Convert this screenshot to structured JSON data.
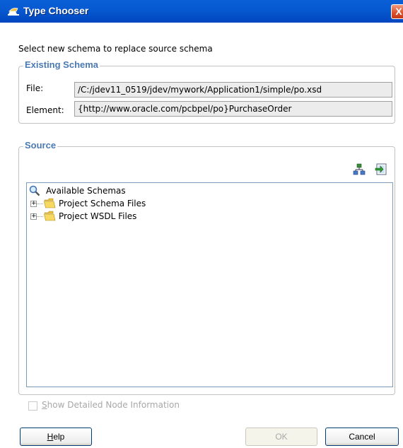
{
  "window": {
    "title": "Type Chooser",
    "close_glyph": "X"
  },
  "instruction": "Select new schema to replace source schema",
  "existing_schema": {
    "legend": "Existing Schema",
    "file_label": "File:",
    "file_value": "/C:/jdev11_0519/jdev/mywork/Application1/simple/po.xsd",
    "element_label": "Element:",
    "element_value": "{http://www.oracle.com/pcbpel/po}PurchaseOrder"
  },
  "source": {
    "legend": "Source",
    "toolbar_icons": [
      "schema-tree-icon",
      "import-schema-icon"
    ],
    "tree": {
      "root": "Available Schemas",
      "children": [
        "Project Schema Files",
        "Project WSDL Files"
      ],
      "expander_glyph": "+"
    }
  },
  "show_detailed": {
    "label_first": "S",
    "label_rest": "how Detailed Node Information",
    "checked": false
  },
  "buttons": {
    "help_first": "H",
    "help_rest": "elp",
    "ok": "OK",
    "cancel": "Cancel"
  },
  "colors": {
    "titlebar": "#0759d0",
    "legend": "#4a79b4"
  }
}
